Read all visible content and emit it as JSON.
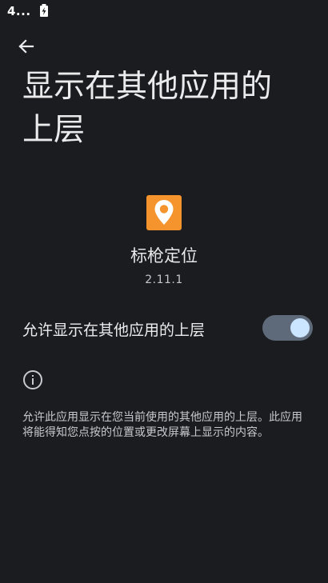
{
  "status_bar": {
    "time": "4...",
    "battery_icon": "battery-charging-icon"
  },
  "toolbar": {
    "back_icon": "arrow-back-icon"
  },
  "page": {
    "title": "显示在其他应用的上层"
  },
  "app": {
    "icon": "location-pin-icon",
    "icon_color": "#f5932c",
    "name": "标枪定位",
    "version": "2.11.1"
  },
  "permission": {
    "label": "允许显示在其他应用的上层",
    "enabled": true,
    "track_color": "#5e6a79",
    "thumb_color": "#cbe4ff"
  },
  "info": {
    "icon": "info-icon",
    "text": "允许此应用显示在您当前使用的其他应用的上层。此应用将能得知您点按的位置或更改屏幕上显示的内容。"
  }
}
